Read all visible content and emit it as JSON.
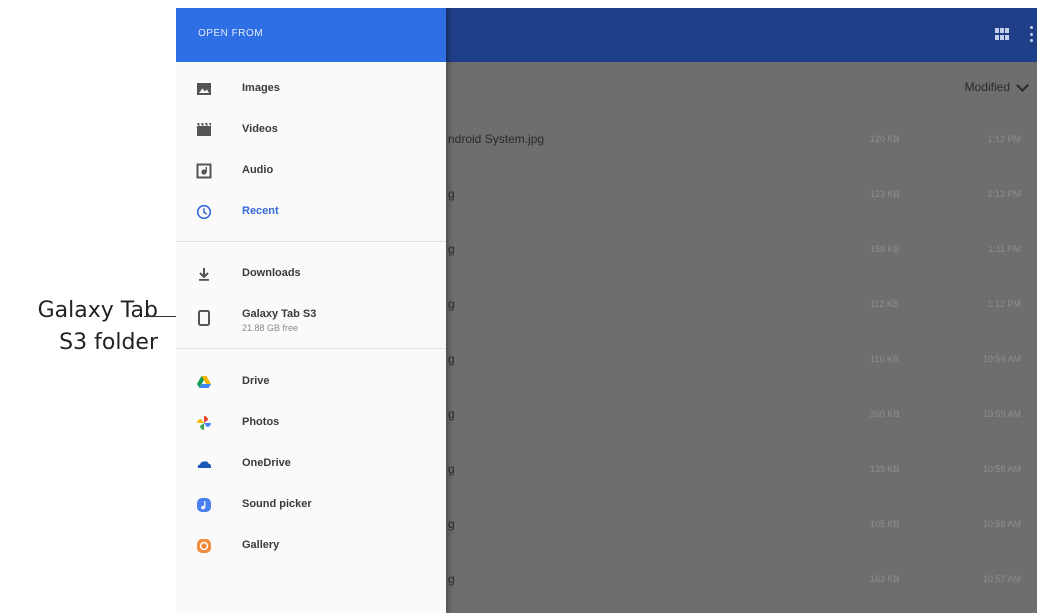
{
  "callout": {
    "text": "Galaxy Tab S3 folder"
  },
  "drawer": {
    "title": "OPEN FROM",
    "groups": [
      [
        {
          "label": "Images",
          "icon": "image-icon"
        },
        {
          "label": "Videos",
          "icon": "video-icon"
        },
        {
          "label": "Audio",
          "icon": "audio-icon"
        },
        {
          "label": "Recent",
          "icon": "clock-icon",
          "active": true
        }
      ],
      [
        {
          "label": "Downloads",
          "icon": "download-icon"
        },
        {
          "label": "Galaxy Tab S3",
          "sub": "21.88 GB free",
          "icon": "tablet-icon"
        }
      ],
      [
        {
          "label": "Drive",
          "icon": "drive-icon"
        },
        {
          "label": "Photos",
          "icon": "photos-icon"
        },
        {
          "label": "OneDrive",
          "icon": "onedrive-icon"
        },
        {
          "label": "Sound picker",
          "icon": "sound-picker-icon"
        },
        {
          "label": "Gallery",
          "icon": "gallery-icon"
        }
      ]
    ]
  },
  "toolbar": {
    "sort_label": "Modified"
  },
  "files": [
    {
      "name": "ndroid System.jpg",
      "size": "120 KB",
      "time": "1:12 PM"
    },
    {
      "name": "g",
      "size": "123 KB",
      "time": "1:12 PM"
    },
    {
      "name": "g",
      "size": "158 KB",
      "time": "1:11 PM"
    },
    {
      "name": "g",
      "size": "112 KB",
      "time": "1:12 PM"
    },
    {
      "name": "g",
      "size": "116 KB",
      "time": "10:59 AM"
    },
    {
      "name": "g",
      "size": "260 KB",
      "time": "10:59 AM"
    },
    {
      "name": "g",
      "size": "139 KB",
      "time": "10:58 AM"
    },
    {
      "name": "g",
      "size": "105 KB",
      "time": "10:58 AM"
    },
    {
      "name": "g",
      "size": "163 KB",
      "time": "10:57 AM"
    }
  ],
  "colors": {
    "drawer_header": "#2f6fe6",
    "app_bar": "#1f3f88",
    "active_item": "#3368d6"
  }
}
